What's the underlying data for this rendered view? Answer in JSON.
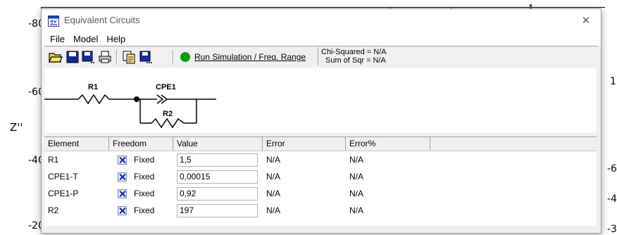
{
  "background": {
    "ylabel": "Z''",
    "left_ticks": [
      "-80",
      "-60",
      "-40",
      "-20"
    ],
    "right_ticks": [
      "1",
      "-6",
      "-4",
      "-3"
    ]
  },
  "window": {
    "title": "Equivalent Circuits",
    "close_glyph": "✕"
  },
  "menu": {
    "items": [
      "File",
      "Model",
      "Help"
    ]
  },
  "toolbar": {
    "icons": [
      "open-folder-icon",
      "save-icon",
      "save-as-icon",
      "print-icon",
      "copy-icon",
      "save-dots-icon"
    ],
    "run_label": "Run Simulation / Freq. Range",
    "chi_squared": "Chi-Squared = N/A",
    "sum_of_sqr": "Sum of Sqr = N/A",
    "run_color": "#0a9e0a"
  },
  "circuit": {
    "r1_label": "R1",
    "cpe1_label": "CPE1",
    "r2_label": "R2"
  },
  "grid": {
    "headers": [
      "Element",
      "Freedom",
      "Value",
      "Error",
      "Error%"
    ],
    "rows": [
      {
        "element": "R1",
        "freedom": "Fixed",
        "value": "1,5",
        "error": "N/A",
        "error_pct": "N/A"
      },
      {
        "element": "CPE1-T",
        "freedom": "Fixed",
        "value": "0,00015",
        "error": "N/A",
        "error_pct": "N/A"
      },
      {
        "element": "CPE1-P",
        "freedom": "Fixed",
        "value": "0,92",
        "error": "N/A",
        "error_pct": "N/A"
      },
      {
        "element": "R2",
        "freedom": "Fixed",
        "value": "197",
        "error": "N/A",
        "error_pct": "N/A"
      }
    ]
  }
}
